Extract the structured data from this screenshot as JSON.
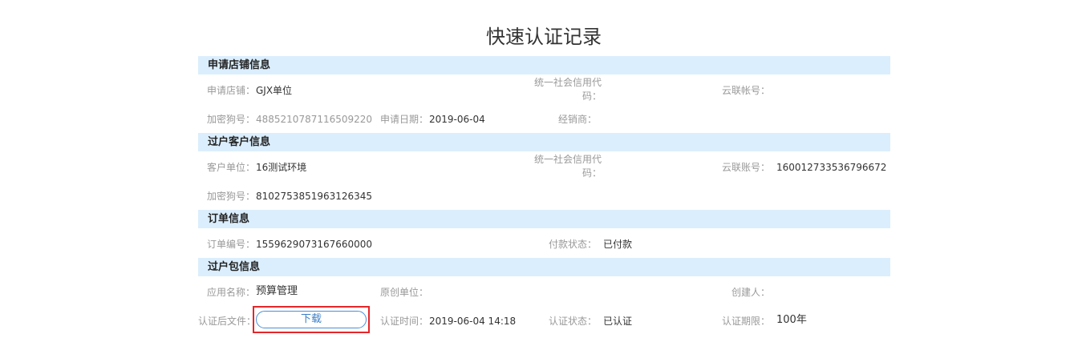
{
  "page": {
    "title": "快速认证记录"
  },
  "sections": {
    "store": {
      "header": "申请店铺信息",
      "store_label": "申请店铺：",
      "store_value": "GJX单位",
      "credit_code_label": "统一社会信用代码：",
      "credit_code_value": "",
      "cloud_account_label": "云联帐号：",
      "cloud_account_value": "",
      "dongle_label": "加密狗号：",
      "dongle_value": "4885210787116509220",
      "apply_date_label": "申请日期：",
      "apply_date_value": "2019-06-04",
      "dealer_label": "经销商：",
      "dealer_value": ""
    },
    "customer": {
      "header": "过户客户信息",
      "unit_label": "客户单位：",
      "unit_value": "16测试环境",
      "credit_code_label": "统一社会信用代码：",
      "credit_code_value": "",
      "cloud_account_label": "云联账号：",
      "cloud_account_value": "160012733536796672",
      "dongle_label": "加密狗号：",
      "dongle_value": "8102753851963126345"
    },
    "order": {
      "header": "订单信息",
      "order_no_label": "订单编号：",
      "order_no_value": "1559629073167660000",
      "pay_status_label": "付款状态：",
      "pay_status_value": "已付款"
    },
    "package": {
      "header": "过户包信息",
      "app_name_label": "应用名称：",
      "app_name_value": "预算管理",
      "origin_unit_label": "原创单位：",
      "origin_unit_value": "",
      "creator_label": "创建人：",
      "creator_value": "",
      "file_label": "认证后文件：",
      "download_label": "下载",
      "auth_time_label": "认证时间：",
      "auth_time_value": "2019-06-04 14:18",
      "auth_status_label": "认证状态：",
      "auth_status_value": "已认证",
      "auth_period_label": "认证期限：",
      "auth_period_value": "100年"
    }
  },
  "colors": {
    "section_bg": "#dbeefd",
    "highlight_border": "#e5262a",
    "button_border": "#4a90d9"
  }
}
